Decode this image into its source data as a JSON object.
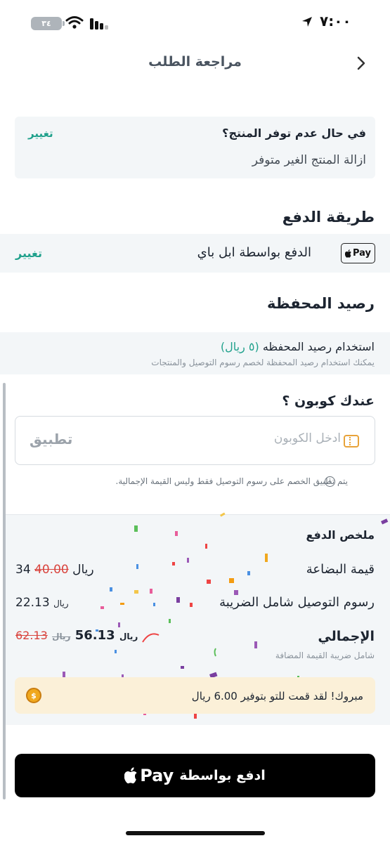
{
  "status_bar": {
    "time": "٧:٠٠",
    "battery": "٣٤"
  },
  "header": {
    "title": "مراجعة الطلب"
  },
  "unavailable": {
    "question": "في حال عدم توفر المنتج؟",
    "answer": "ازالة المنتج الغير متوفر",
    "change_label": "تغيير"
  },
  "payment": {
    "section_title": "طريقة الدفع",
    "method_label": "الدفع بواسطة ابل باي",
    "badge": "Pay",
    "change_label": "تغيير"
  },
  "wallet": {
    "section_title": "رصيد المحفظة",
    "use_label": "استخدام رصيد المحفظه",
    "amount": "(٥ ريال)",
    "subtitle": "يمكنك استخدام رصيد المحفظة لخصم رسوم التوصيل والمنتجات"
  },
  "coupon": {
    "title": "عندك كوبون ؟",
    "placeholder": "ادخل الكوبون",
    "apply_label": "تطبيق",
    "note": "يتم تطبيق الخصم على رسوم التوصيل فقط وليس القيمة الإجمالية."
  },
  "summary": {
    "title": "ملخص الدفع",
    "items_label": "قيمة البضاعة",
    "items_old": "40.00",
    "items_value": "34 ريال",
    "delivery_label": "رسوم التوصيل شامل الضريبة",
    "delivery_value": "22.13",
    "delivery_currency": "ريال",
    "total_label": "الإجمالي",
    "total_old": "62.13",
    "total_old_currency": "ريال",
    "total_value": "56.13",
    "total_currency": "ريال",
    "vat_note": "شامل ضريبة القيمة المضافة",
    "savings_text": "مبروك! لقد قمت للتو بتوفير 6.00 ريال"
  },
  "pay_button": {
    "label": "ادفع بواسطة",
    "brand": "Pay"
  },
  "colors": {
    "accent": "#20a18c",
    "strike": "#d9443e",
    "banner": "#fbf0d8"
  }
}
